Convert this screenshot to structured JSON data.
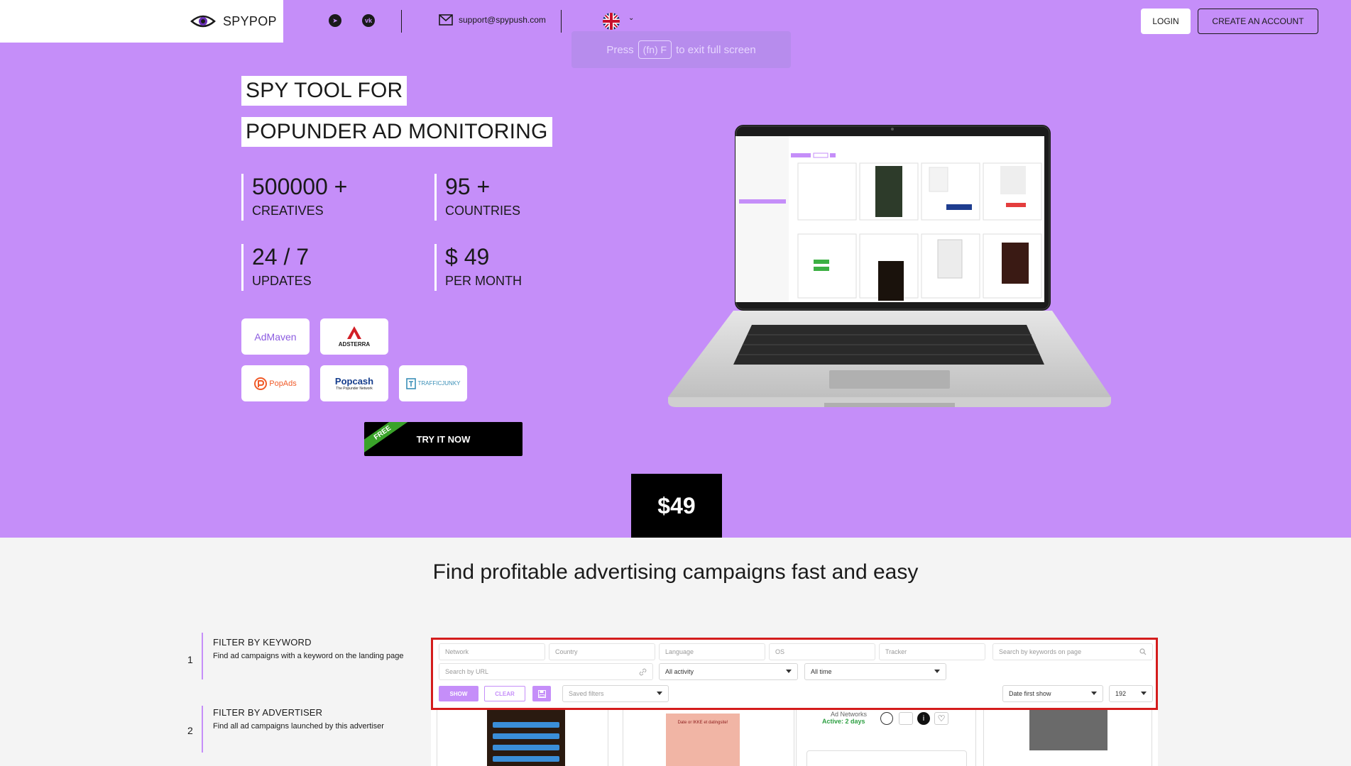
{
  "header": {
    "logo_text": "SPYPOP",
    "email": "support@spypush.com",
    "language_flag": "uk-flag-icon",
    "login_label": "LOGIN",
    "create_account_label": "CREATE AN ACCOUNT",
    "fullscreen_hint": {
      "prefix": "Press",
      "key": "(fn) F",
      "suffix": "to exit full screen"
    }
  },
  "hero": {
    "title_line1": "SPY TOOL FOR",
    "title_line2": "POPUNDER AD MONITORING",
    "stats": [
      {
        "value": "500000 +",
        "label": "CREATIVES"
      },
      {
        "value": "95 +",
        "label": "COUNTRIES"
      },
      {
        "value": "24 / 7",
        "label": "UPDATES"
      },
      {
        "value": "$ 49",
        "label": "PER MONTH"
      }
    ],
    "networks": {
      "admaven": "AdMaven",
      "adsterra": "ADSTERRA",
      "popads": "PopAds",
      "popcash": "Popcash",
      "popcash_sub": "The Popunder Network",
      "trafficjunky": "TRAFFICJUNKY"
    },
    "try_label": "TRY IT NOW",
    "free_badge": "FREE",
    "price": "$49"
  },
  "section": {
    "title": "Find profitable advertising campaigns fast and easy",
    "steps": [
      {
        "num": "1",
        "heading": "FILTER BY KEYWORD",
        "desc": "Find ad campaigns with a keyword on the landing page"
      },
      {
        "num": "2",
        "heading": "FILTER BY ADVERTISER",
        "desc": "Find all ad campaigns launched by this advertiser"
      }
    ]
  },
  "filters": {
    "network": "Network",
    "country": "Country",
    "language": "Language",
    "os": "OS",
    "tracker": "Tracker",
    "keywords": "Search by keywords on page",
    "url": "Search by URL",
    "activity": "All activity",
    "time": "All time",
    "show": "SHOW",
    "clear": "CLEAR",
    "saved": "Saved filters",
    "sort": "Date first show",
    "count": "192"
  },
  "results": {
    "card2_text": "Date or IKKE et datingsite!",
    "card3_title": "Ad Networks",
    "card3_status": "Active: 2 days"
  },
  "colors": {
    "hero_bg": "#c58ef9",
    "accent": "#c58ef9",
    "highlight_border": "#d41c1c",
    "free_badge": "#3aa32a"
  }
}
